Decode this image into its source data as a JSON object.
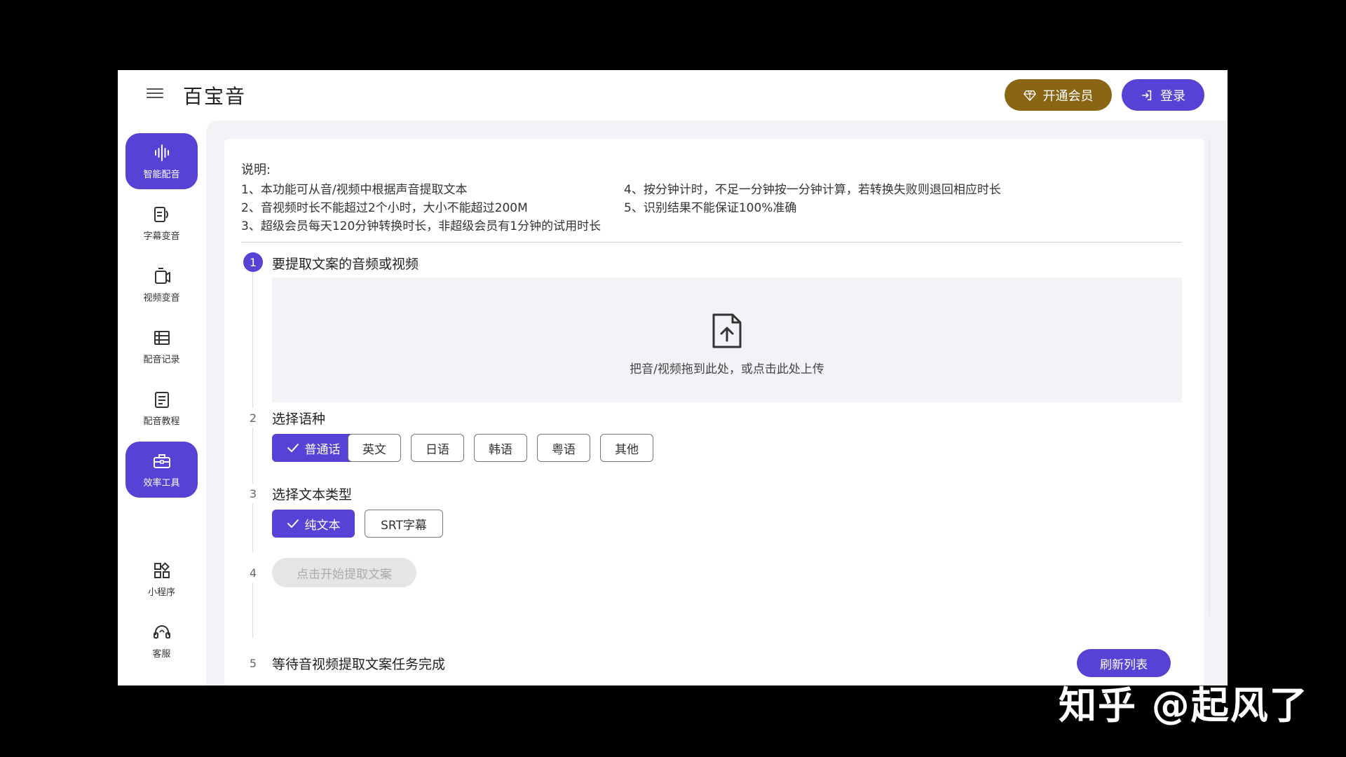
{
  "header": {
    "app_title": "百宝音",
    "vip_label": "开通会员",
    "login_label": "登录"
  },
  "sidebar": {
    "items": [
      {
        "label": "智能配音",
        "icon": "audio-wave-icon",
        "active": true
      },
      {
        "label": "字幕变音",
        "icon": "subtitle-voice-icon",
        "active": false
      },
      {
        "label": "视频变音",
        "icon": "video-voice-icon",
        "active": false
      },
      {
        "label": "配音记录",
        "icon": "list-icon",
        "active": false
      },
      {
        "label": "配音教程",
        "icon": "document-icon",
        "active": false
      },
      {
        "label": "效率工具",
        "icon": "toolbox-icon",
        "active": true
      },
      {
        "label": "小程序",
        "icon": "mini-program-icon",
        "active": false
      },
      {
        "label": "客服",
        "icon": "headset-icon",
        "active": false
      }
    ]
  },
  "notes": {
    "title": "说明:",
    "left": [
      "1、本功能可从音/视频中根据声音提取文本",
      "2、音视频时长不能超过2个小时，大小不能超过200M",
      "3、超级会员每天120分钟转换时长，非超级会员有1分钟的试用时长"
    ],
    "right": [
      "4、按分钟计时，不足一分钟按一分钟计算，若转换失败则退回相应时长",
      "5、识别结果不能保证100%准确"
    ]
  },
  "steps": [
    {
      "num": "1",
      "title": "要提取文案的音频或视频"
    },
    {
      "num": "2",
      "title": "选择语种"
    },
    {
      "num": "3",
      "title": "选择文本类型"
    },
    {
      "num": "4",
      "title": ""
    },
    {
      "num": "5",
      "title": "等待音视频提取文案任务完成"
    }
  ],
  "upload": {
    "hint": "把音/视频拖到此处，或点击此处上传",
    "icon": "file-upload-icon"
  },
  "languages": {
    "options": [
      "普通话",
      "英文",
      "日语",
      "韩语",
      "粤语",
      "其他"
    ],
    "selected": "普通话"
  },
  "text_types": {
    "options": [
      "纯文本",
      "SRT字幕"
    ],
    "selected": "纯文本"
  },
  "actions": {
    "start_label": "点击开始提取文案",
    "refresh_label": "刷新列表"
  },
  "watermark": "知乎 @起风了",
  "colors": {
    "accent": "#5642d4",
    "vip": "#8a6614",
    "panel_bg": "#f2f3f7"
  }
}
